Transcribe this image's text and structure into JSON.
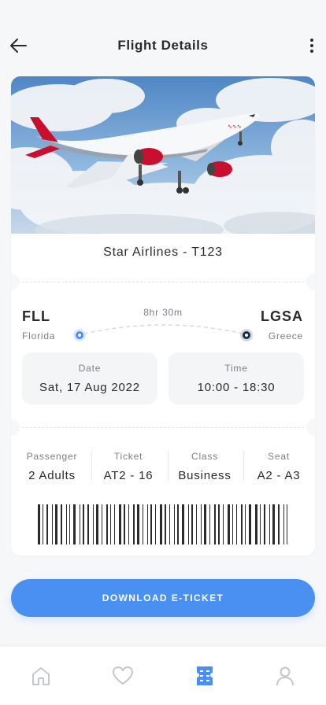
{
  "header": {
    "title": "Flight Details",
    "back_icon": "arrow-left-icon",
    "menu_icon": "more-vertical-icon"
  },
  "flight": {
    "airline": "Star Airlines - T123",
    "origin_code": "FLL",
    "origin_city": "Florida",
    "destination_code": "LGSA",
    "destination_city": "Greece",
    "duration": "8hr 30m"
  },
  "schedule": {
    "date_label": "Date",
    "date_value": "Sat, 17 Aug 2022",
    "time_label": "Time",
    "time_value": "10:00 - 18:30"
  },
  "details": [
    {
      "label": "Passenger",
      "value": "2 Adults"
    },
    {
      "label": "Ticket",
      "value": "AT2 - 16"
    },
    {
      "label": "Class",
      "value": "Business"
    },
    {
      "label": "Seat",
      "value": "A2 - A3"
    }
  ],
  "actions": {
    "download_label": "DOWNLOAD E-TICKET"
  },
  "tabs": [
    {
      "icon": "home-icon",
      "active": false
    },
    {
      "icon": "heart-icon",
      "active": false
    },
    {
      "icon": "ticket-icon",
      "active": true
    },
    {
      "icon": "profile-icon",
      "active": false
    }
  ],
  "colors": {
    "accent": "#4a90f3",
    "destination_dot": "#13314f",
    "inactive_icon": "#c4c7cc",
    "background": "#f6f7f9"
  }
}
